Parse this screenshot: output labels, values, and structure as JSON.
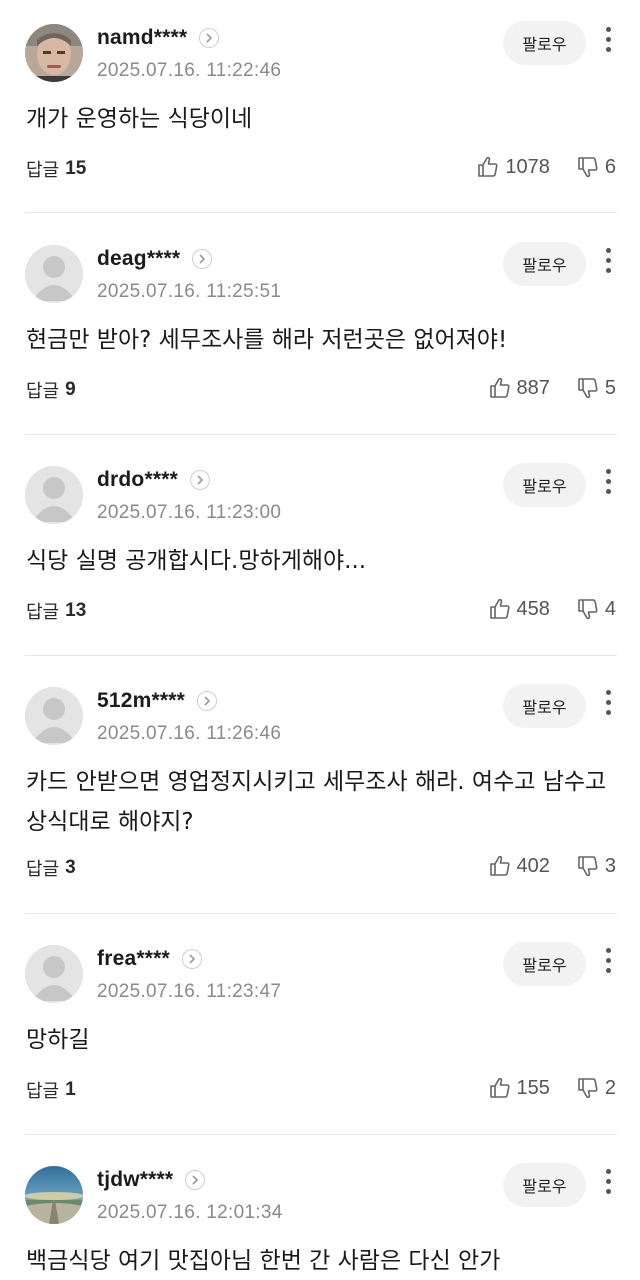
{
  "follow_label": "팔로우",
  "reply_label": "답글",
  "comments": [
    {
      "username": "namd****",
      "timestamp": "2025.07.16. 11:22:46",
      "body": "개가 운영하는 식당이네",
      "replies": "15",
      "likes": "1078",
      "dislikes": "6",
      "avatar": "profile-photo"
    },
    {
      "username": "deag****",
      "timestamp": "2025.07.16. 11:25:51",
      "body": "현금만 받아? 세무조사를 해라 저런곳은 없어져야!",
      "replies": "9",
      "likes": "887",
      "dislikes": "5",
      "avatar": "default-avatar"
    },
    {
      "username": "drdo****",
      "timestamp": "2025.07.16. 11:23:00",
      "body": "식당 실명 공개합시다.망하게해야...",
      "replies": "13",
      "likes": "458",
      "dislikes": "4",
      "avatar": "default-avatar"
    },
    {
      "username": "512m****",
      "timestamp": "2025.07.16. 11:26:46",
      "body": "카드 안받으면 영업정지시키고 세무조사 해라. 여수고 남수고 상식대로 해야지?",
      "replies": "3",
      "likes": "402",
      "dislikes": "3",
      "avatar": "default-avatar"
    },
    {
      "username": "frea****",
      "timestamp": "2025.07.16. 11:23:47",
      "body": "망하길",
      "replies": "1",
      "likes": "155",
      "dislikes": "2",
      "avatar": "default-avatar"
    },
    {
      "username": "tjdw****",
      "timestamp": "2025.07.16. 12:01:34",
      "body": "백금식당 여기 맛집아님 한번 간 사람은 다신 안가",
      "replies": "",
      "likes": "",
      "dislikes": "",
      "avatar": "landscape-photo"
    }
  ],
  "colors": {
    "username": "#1c1c1c",
    "timestamp": "#8a8a8a",
    "follow_button_bg": "#f2f2f2",
    "divider": "#e8e8e8"
  }
}
